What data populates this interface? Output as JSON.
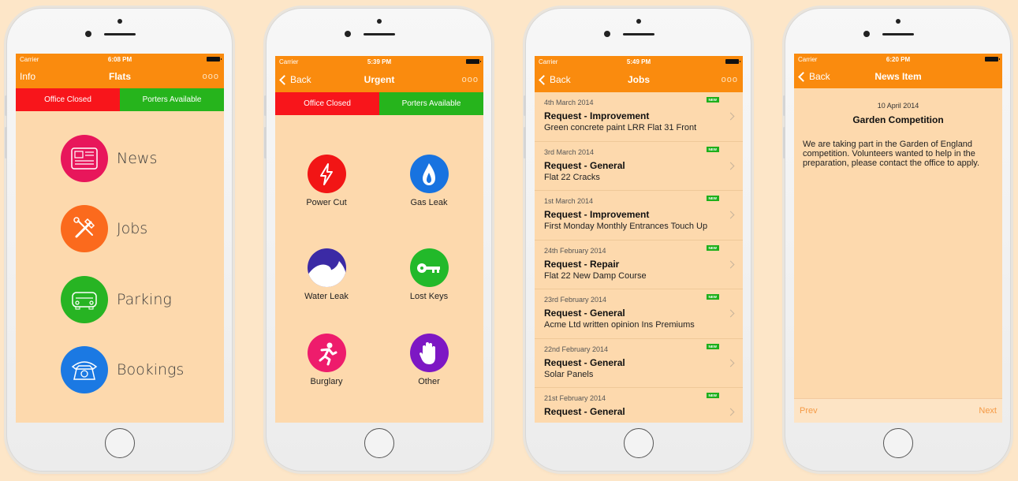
{
  "colors": {
    "page_background": "#fde6c8",
    "screen_background": "#fdd9ad",
    "navbar": "#fa8b0e",
    "office_closed": "#f8151b",
    "porters_available": "#26b41c",
    "news_badge": "#1eaf1b"
  },
  "phone1": {
    "status": {
      "carrier": "Carrier",
      "time": "6:08 PM"
    },
    "nav": {
      "left": "Info",
      "title": "Flats",
      "right": "ooo"
    },
    "status_bar": {
      "left": "Office Closed",
      "right": "Porters Available"
    },
    "menu": [
      {
        "label": "News",
        "icon": "newspaper-icon",
        "color": "#e8165b"
      },
      {
        "label": "Jobs",
        "icon": "tools-icon",
        "color": "#fb6a1d"
      },
      {
        "label": "Parking",
        "icon": "car-icon",
        "color": "#27b423"
      },
      {
        "label": "Bookings",
        "icon": "telephone-icon",
        "color": "#1b79e3"
      }
    ]
  },
  "phone2": {
    "status": {
      "carrier": "Carrier",
      "time": "5:39 PM"
    },
    "nav": {
      "left": "Back",
      "title": "Urgent",
      "right": "ooo"
    },
    "status_bar": {
      "left": "Office Closed",
      "right": "Porters Available"
    },
    "items": [
      {
        "label": "Power Cut",
        "icon": "lightning-icon",
        "color": "#f21515"
      },
      {
        "label": "Gas Leak",
        "icon": "flame-icon",
        "color": "#1873e0"
      },
      {
        "label": "Water Leak",
        "icon": "wave-icon",
        "color": "#3b2aa5"
      },
      {
        "label": "Lost Keys",
        "icon": "key-icon",
        "color": "#22b92a"
      },
      {
        "label": "Burglary",
        "icon": "running-man-icon",
        "color": "#ee1c6c"
      },
      {
        "label": "Other",
        "icon": "hand-icon",
        "color": "#7d17c4"
      }
    ]
  },
  "phone3": {
    "status": {
      "carrier": "Carrier",
      "time": "5:49 PM"
    },
    "nav": {
      "left": "Back",
      "title": "Jobs",
      "right": "ooo"
    },
    "badge": "NEW",
    "jobs": [
      {
        "date": "4th March 2014",
        "type": "Request - Improvement",
        "desc": "Green concrete paint LRR Flat 31 Front"
      },
      {
        "date": "3rd March 2014",
        "type": "Request - General",
        "desc": "Flat 22 Cracks"
      },
      {
        "date": "1st March 2014",
        "type": "Request - Improvement",
        "desc": "First Monday Monthly Entrances Touch Up"
      },
      {
        "date": "24th February 2014",
        "type": "Request - Repair",
        "desc": "Flat 22 New Damp Course"
      },
      {
        "date": "23rd February 2014",
        "type": "Request - General",
        "desc": "Acme Ltd written opinion Ins Premiums"
      },
      {
        "date": "22nd February 2014",
        "type": "Request - General",
        "desc": "Solar Panels"
      },
      {
        "date": "21st February 2014",
        "type": "Request - General",
        "desc": ""
      }
    ]
  },
  "phone4": {
    "status": {
      "carrier": "Carrier",
      "time": "6:20 PM"
    },
    "nav": {
      "left": "Back",
      "title": "News Item"
    },
    "article": {
      "date": "10 April 2014",
      "title": "Garden Competition",
      "body": "We are taking part in the Garden of England competition. Volunteers wanted to help in the preparation, please contact the office to apply."
    },
    "footer": {
      "prev": "Prev",
      "next": "Next"
    }
  }
}
